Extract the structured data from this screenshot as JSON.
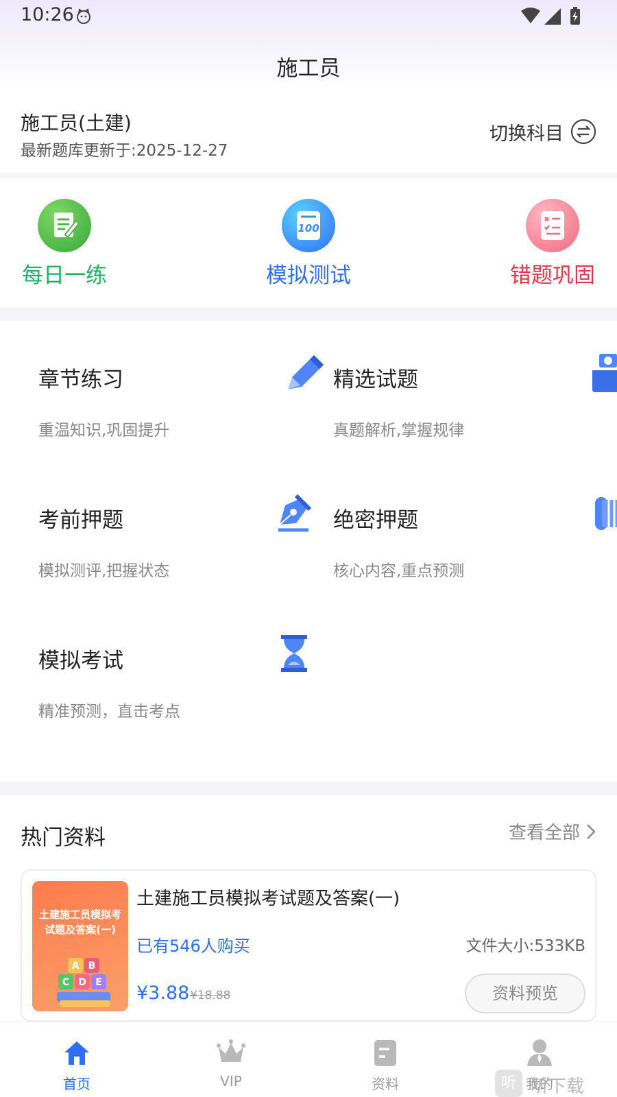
{
  "status_bar": {
    "time": "10:26"
  },
  "header": {
    "title": "施工员"
  },
  "subject": {
    "name": "施工员(土建)",
    "update_text": "最新题库更新于:2025-12-27",
    "switch_label": "切换科目"
  },
  "quick_actions": [
    {
      "label": "每日一练",
      "color": "#1ab362",
      "icon": "notepad-pen-icon"
    },
    {
      "label": "模拟测试",
      "color": "#2f6ef3",
      "icon": "score-100-icon"
    },
    {
      "label": "错题巩固",
      "color": "#e8334a",
      "icon": "checklist-icon"
    }
  ],
  "modules": [
    {
      "title": "章节练习",
      "subtitle": "重温知识,巩固提升",
      "icon": "pencil-icon"
    },
    {
      "title": "精选试题",
      "subtitle": "真题解析,掌握规律",
      "icon": "thumbs-up-icon"
    },
    {
      "title": "考前押题",
      "subtitle": "模拟测评,把握状态",
      "icon": "fountain-pen-icon"
    },
    {
      "title": "绝密押题",
      "subtitle": "核心内容,重点预测",
      "icon": "scroll-icon"
    },
    {
      "title": "模拟考试",
      "subtitle": "精准预测，直击考点",
      "icon": "hourglass-icon"
    }
  ],
  "hot": {
    "heading": "热门资料",
    "view_all": "查看全部",
    "items": [
      {
        "cover_text": "土建施工员模拟考试题及答案(一)",
        "cover_letters": [
          "A",
          "B",
          "C",
          "D",
          "E"
        ],
        "title": "土建施工员模拟考试题及答案(一)",
        "buyers": "已有546人购买",
        "file_size": "文件大小:533KB",
        "price": "¥3.88",
        "original_price": "¥18.88",
        "preview_label": "资料预览"
      }
    ]
  },
  "tabbar": [
    {
      "label": "首页",
      "icon": "home-icon",
      "active": true
    },
    {
      "label": "VIP",
      "icon": "crown-icon",
      "active": false
    },
    {
      "label": "资料",
      "icon": "document-icon",
      "active": false
    },
    {
      "label": "我的",
      "icon": "person-icon",
      "active": false
    }
  ],
  "watermark": {
    "box": "听",
    "text": "听下载"
  },
  "colors": {
    "accent": "#2f6ef3",
    "inactive": "#999999"
  }
}
